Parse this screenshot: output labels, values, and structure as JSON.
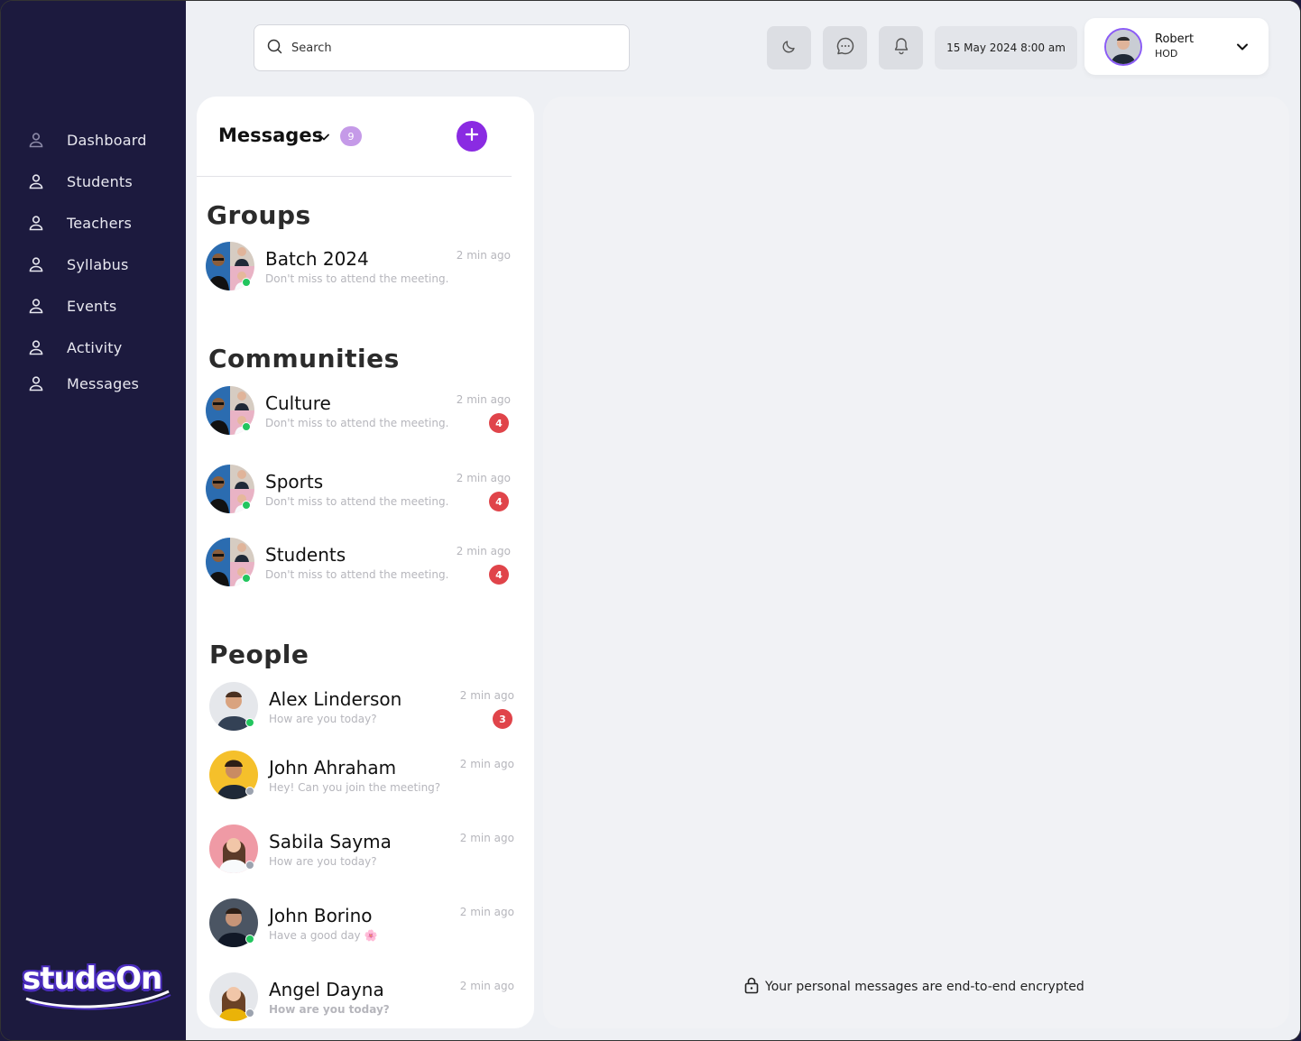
{
  "sidebar": {
    "items": [
      {
        "label": "Dashboard",
        "icon": "user-icon"
      },
      {
        "label": "Students",
        "icon": "user-icon"
      },
      {
        "label": "Teachers",
        "icon": "user-icon"
      },
      {
        "label": "Syllabus",
        "icon": "user-icon"
      },
      {
        "label": "Events",
        "icon": "user-icon"
      },
      {
        "label": "Activity",
        "icon": "user-icon"
      },
      {
        "label": "Messages",
        "icon": "user-icon"
      }
    ],
    "logo_text": "studeOn"
  },
  "topbar": {
    "search_placeholder": "Search",
    "datetime": "15 May 2024 8:00 am",
    "user": {
      "name": "Robert",
      "role": "HOD"
    }
  },
  "messages": {
    "title": "Messages",
    "count": "9",
    "sections": {
      "groups": "Groups",
      "communities": "Communities",
      "people": "People"
    },
    "groups": [
      {
        "name": "Batch 2024",
        "message": "Don't miss to attend the meeting.",
        "time": "2 min ago",
        "online": true
      }
    ],
    "communities": [
      {
        "name": "Culture",
        "message": "Don't miss to attend the meeting.",
        "time": "2 min ago",
        "unread": "4",
        "online": true
      },
      {
        "name": "Sports",
        "message": "Don't miss to attend the meeting.",
        "time": "2 min ago",
        "unread": "4",
        "online": true
      },
      {
        "name": "Students",
        "message": "Don't miss to attend the meeting.",
        "time": "2 min ago",
        "unread": "4",
        "online": true
      }
    ],
    "people": [
      {
        "name": "Alex Linderson",
        "message": "How are you today?",
        "time": "2 min ago",
        "unread": "3",
        "online": true
      },
      {
        "name": "John Ahraham",
        "message": "Hey! Can you join the meeting?",
        "time": "2 min ago",
        "online": false
      },
      {
        "name": "Sabila Sayma",
        "message": "How are you today?",
        "time": "2 min ago",
        "online": false
      },
      {
        "name": "John Borino",
        "message": "Have a good day 🌸",
        "time": "2 min ago",
        "online": true
      },
      {
        "name": "Angel Dayna",
        "message": "How are you today?",
        "time": "2 min ago",
        "online": false
      }
    ]
  },
  "conversation": {
    "encryption_notice": "Your personal messages are end-to-end encrypted"
  },
  "colors": {
    "sidebar": "#1c1a3e",
    "accent": "#8a2be2",
    "badge_red": "#e0444a",
    "online": "#22c55e"
  }
}
